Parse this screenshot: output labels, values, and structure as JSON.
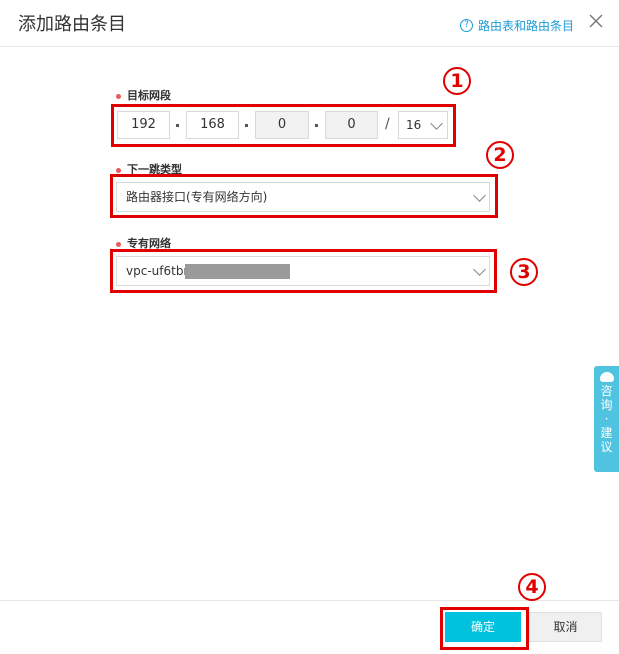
{
  "dialog": {
    "title": "添加路由条目",
    "help_link": "路由表和路由条目",
    "help_icon": "?"
  },
  "form": {
    "cidr": {
      "label": "目标网段",
      "octets": [
        "192",
        "168",
        "0",
        "0"
      ],
      "separator": "/",
      "mask": "16"
    },
    "next_hop_type": {
      "label": "下一跳类型",
      "value": "路由器接口(专有网络方向)"
    },
    "vpc": {
      "label": "专有网络",
      "value": "vpc-uf6tbn"
    }
  },
  "annotations": {
    "badges": [
      "1",
      "2",
      "3",
      "4"
    ],
    "highlight_color": "#e00000"
  },
  "side_tab": {
    "chars": [
      "咨",
      "询",
      "·",
      "建",
      "议"
    ]
  },
  "footer": {
    "confirm_label": "确定",
    "cancel_label": "取消"
  },
  "colors": {
    "primary": "#00c1de",
    "link": "#1a9bd7",
    "required_dot": "#e95b5b"
  }
}
